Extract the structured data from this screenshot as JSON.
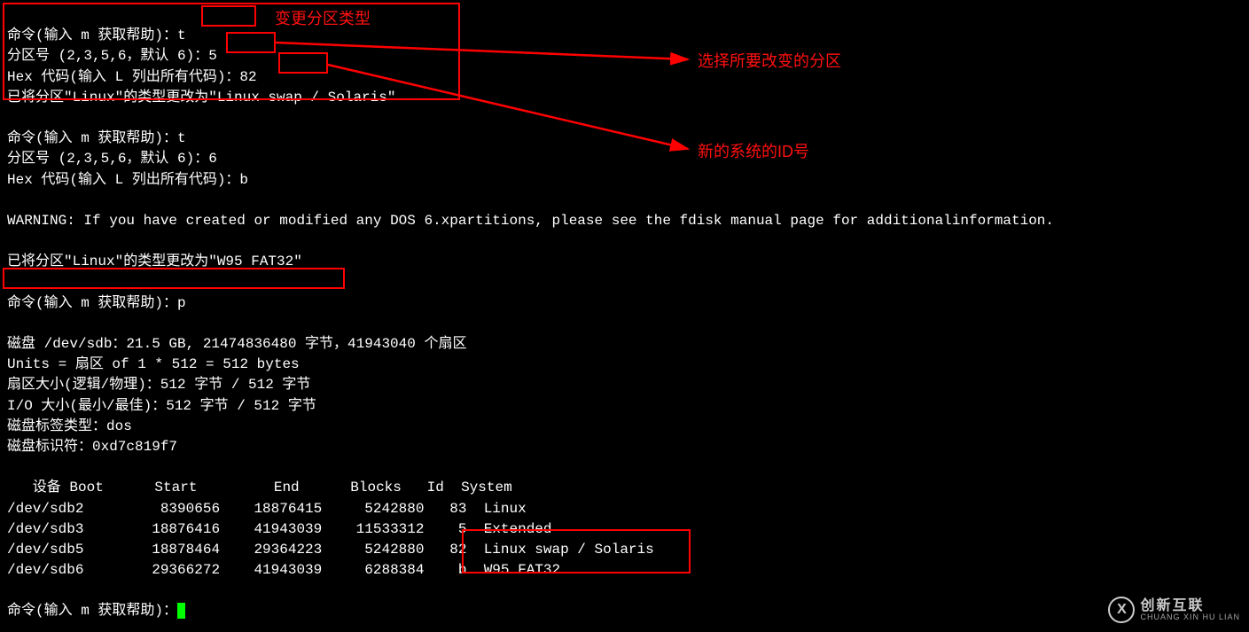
{
  "annotations": {
    "change_type": "变更分区类型",
    "select_partition": "选择所要改变的分区",
    "new_system_id": "新的系统的ID号"
  },
  "block1": {
    "prompt1": "命令(输入 m 获取帮助)：t",
    "prompt2": "分区号 (2,3,5,6，默认 6)：5",
    "prompt3": "Hex 代码(输入 L 列出所有代码)：82",
    "result": "已将分区\"Linux\"的类型更改为\"Linux swap / Solaris\""
  },
  "block2": {
    "prompt1": "命令(输入 m 获取帮助)：t",
    "prompt2": "分区号 (2,3,5,6，默认 6)：6",
    "prompt3": "Hex 代码(输入 L 列出所有代码)：b",
    "blank": "",
    "warning": "WARNING: If you have created or modified any DOS 6.xpartitions, please see the fdisk manual page for additionalinformation.",
    "blank2": "",
    "result": "已将分区\"Linux\"的类型更改为\"W95 FAT32\""
  },
  "block3": {
    "prompt": "命令(输入 m 获取帮助)：p",
    "disk": "磁盘 /dev/sdb：21.5 GB, 21474836480 字节，41943040 个扇区",
    "units": "Units = 扇区 of 1 * 512 = 512 bytes",
    "sector": "扇区大小(逻辑/物理)：512 字节 / 512 字节",
    "io": "I/O 大小(最小/最佳)：512 字节 / 512 字节",
    "label": "磁盘标签类型：dos",
    "ident": "磁盘标识符：0xd7c819f7"
  },
  "table": {
    "header": "   设备 Boot      Start         End      Blocks   Id  System",
    "rows": [
      "/dev/sdb2         8390656    18876415     5242880   83  Linux",
      "/dev/sdb3        18876416    41943039    11533312    5  Extended",
      "/dev/sdb5        18878464    29364223     5242880   82  Linux swap / Solaris",
      "/dev/sdb6        29366272    41943039     6288384    b  W95 FAT32"
    ]
  },
  "final_prompt": "命令(输入 m 获取帮助)：",
  "watermark": {
    "icon": "X",
    "main": "创新互联",
    "sub": "CHUANG XIN HU LIAN"
  }
}
